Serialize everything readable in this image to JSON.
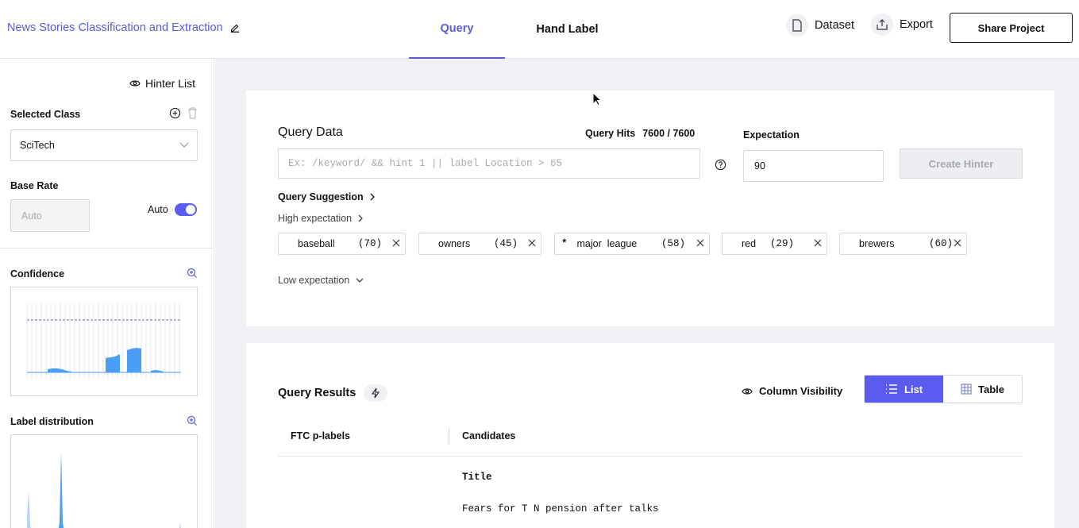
{
  "header": {
    "project_title": "News Stories Classification and Extraction",
    "tabs": [
      {
        "label": "Query",
        "active": true
      },
      {
        "label": "Hand Label",
        "active": false
      }
    ],
    "dataset_label": "Dataset",
    "export_label": "Export",
    "share_label": "Share Project"
  },
  "sidebar": {
    "hinter_list_label": "Hinter List",
    "selected_class_label": "Selected Class",
    "selected_class_value": "SciTech",
    "base_rate_label": "Base Rate",
    "base_rate_placeholder": "Auto",
    "auto_label": "Auto",
    "auto_enabled": true,
    "confidence_label": "Confidence",
    "label_distribution_label": "Label distribution"
  },
  "query": {
    "title": "Query Data",
    "hits_label": "Query Hits",
    "hits_value": "7600 / 7600",
    "input_placeholder": "Ex: /keyword/ && hint 1 || label Location > 65",
    "expectation_label": "Expectation",
    "expectation_value": "90",
    "create_hinter_label": "Create Hinter",
    "suggestion_label": "Query Suggestion",
    "high_expectation_label": "High expectation",
    "low_expectation_label": "Low expectation",
    "chips": [
      {
        "prefix": "",
        "term": "baseball",
        "count": "(70)"
      },
      {
        "prefix": "",
        "term": "owners",
        "count": "(45)"
      },
      {
        "prefix": "*",
        "term": "major  league",
        "count": "(58)"
      },
      {
        "prefix": "",
        "term": "red",
        "count": "(29)"
      },
      {
        "prefix": "",
        "term": "brewers",
        "count": "(60)"
      }
    ]
  },
  "results": {
    "title": "Query Results",
    "column_visibility_label": "Column Visibility",
    "view_list_label": "List",
    "view_table_label": "Table",
    "columns": [
      "FTC p-labels",
      "Candidates"
    ],
    "row_field_label": "Title",
    "row_field_value": "Fears for T N pension after talks"
  },
  "colors": {
    "accent": "#5b5bd6",
    "toggle": "#5b5bf2",
    "chart_bar": "#4a9ef5"
  }
}
